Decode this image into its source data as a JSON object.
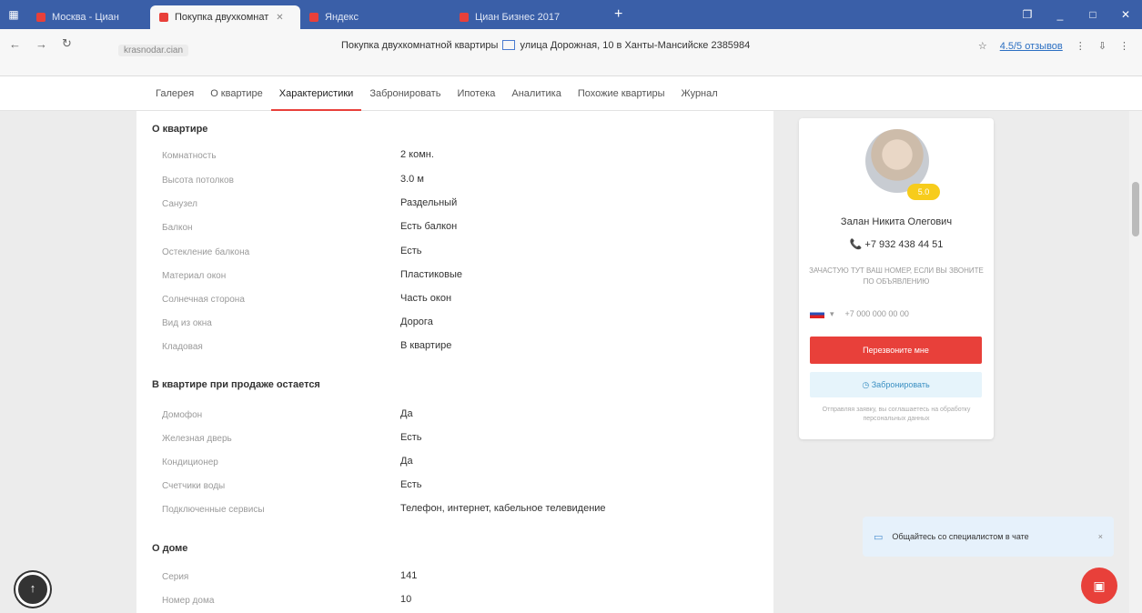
{
  "browser": {
    "tabs": [
      {
        "label": "Москва - Циан",
        "color": "#e8403a",
        "active": false
      },
      {
        "label": "Покупка двухкомнат",
        "color": "#e8403a",
        "active": true
      },
      {
        "label": "Яндекс",
        "color": "#e8403a",
        "active": false
      },
      {
        "label": "Циан Бизнес 2017",
        "color": "#e8403a",
        "active": false
      }
    ],
    "new_tab": "+",
    "window_controls": [
      "❐",
      "_",
      "□",
      "✕"
    ],
    "nav": {
      "back": "←",
      "forward": "→",
      "reload": "↻"
    },
    "url": "krasnodar.cian",
    "page_title_text": "Покупка двухкомнатной квартиры",
    "page_title_rest": "улица Дорожная, 10 в Ханты-Мансийске 2385984",
    "rating_link": "4.5/5 отзывов",
    "addr_icons": [
      "☆",
      "⋮",
      "⇩",
      "⋮"
    ]
  },
  "pagenav": {
    "items": [
      "Галерея",
      "О квартире",
      "Характеристики",
      "Забронировать",
      "Ипотека",
      "Аналитика",
      "Похожие квартиры",
      "Журнал"
    ]
  },
  "sections": {
    "apartment_title": "О квартире",
    "apartment_rows": [
      {
        "label": "Комнатность",
        "value": "2 комн."
      },
      {
        "label": "Высота потолков",
        "value": "3.0 м"
      },
      {
        "label": "Санузел",
        "value": "Раздельный"
      },
      {
        "label": "Балкон",
        "value": "Есть балкон"
      },
      {
        "label": "Остекление балкона",
        "value": "Есть"
      },
      {
        "label": "Материал окон",
        "value": "Пластиковые"
      },
      {
        "label": "Солнечная сторона",
        "value": "Часть окон"
      },
      {
        "label": "Вид из окна",
        "value": "Дорога"
      },
      {
        "label": "Кладовая",
        "value": "В квартире"
      }
    ],
    "included_title": "В квартире при продаже остается",
    "included_rows": [
      {
        "label": "Домофон",
        "value": "Да"
      },
      {
        "label": "Железная дверь",
        "value": "Есть"
      },
      {
        "label": "Кондиционер",
        "value": "Да"
      },
      {
        "label": "Счетчики воды",
        "value": "Есть"
      },
      {
        "label": "Подключенные сервисы",
        "value": "Телефон, интернет, кабельное телевидение"
      }
    ],
    "house_title": "О доме",
    "house_rows": [
      {
        "label": "Серия",
        "value": "141"
      },
      {
        "label": "Номер дома",
        "value": "10"
      }
    ]
  },
  "agent": {
    "rating_badge": "5.0",
    "name": "Залан Никита Олегович",
    "phone": "+7 932 438 44 51",
    "note": "ЗАЧАСТУЮ ТУТ ВАШ НОМЕР, ЕСЛИ ВЫ ЗВОНИТЕ ПО ОБЪЯВЛЕНИЮ",
    "country_code": "▾",
    "phone_placeholder": "+7 000 000 00 00",
    "call_button": "Перезвоните мне",
    "book_button": "Забронировать",
    "consent": "Отправляя заявку, вы соглашаетесь на обработку персональных данных"
  },
  "chat": {
    "text": "Общайтесь со специалистом в чате",
    "close": "×"
  },
  "fab": {
    "left": "↑",
    "right": "▣"
  }
}
